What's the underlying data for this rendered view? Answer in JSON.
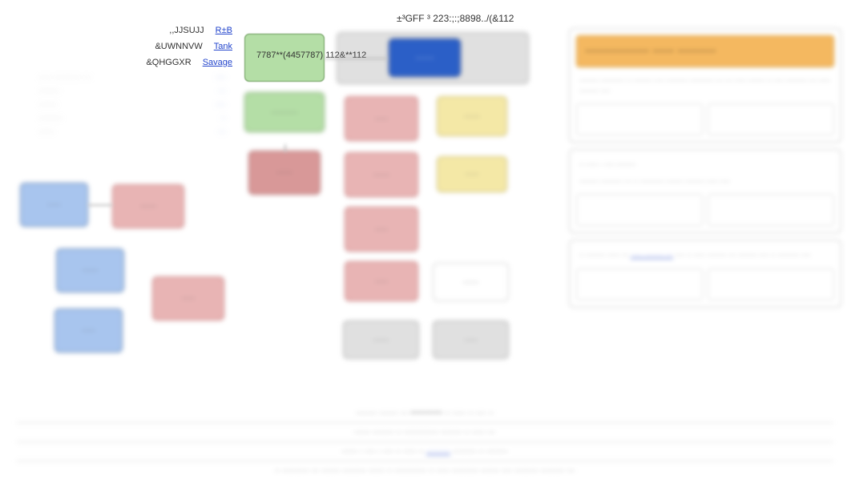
{
  "header": {
    "text": "±³GFF ³ 223:;:;8898../(&112"
  },
  "stats": {
    "rows": [
      {
        "label": ",,JJSUJJ",
        "link": "R±B"
      },
      {
        "label": "&UWNNVW",
        "link": "Tank"
      },
      {
        "label": "&QHGGXR",
        "link": "Savage"
      }
    ],
    "blur_rows": [
      {
        "label": "····· ·········· ···",
        "link": "····"
      },
      {
        "label": "········",
        "link": "···"
      },
      {
        "label": "·······",
        "link": "····"
      },
      {
        "label": "·········",
        "link": "··"
      },
      {
        "label": "······",
        "link": "···"
      }
    ]
  },
  "graph": {
    "focus_label": "7787**(4457787) 112&**112",
    "nodes": {
      "g1": "·····",
      "g2": "··········",
      "g3": "·····",
      "bd": "·······",
      "p1": "······",
      "p2": "·····",
      "p3": "······",
      "p4": "·····",
      "p5": "·····",
      "y1": "······",
      "y2": "·····",
      "b1": "·····",
      "b2": "······",
      "b3": "·····",
      "pk1": "······",
      "pk2": "·····",
      "gr1": "······",
      "gr2": "·····",
      "w1": "······",
      "w2": "·····"
    }
  },
  "right_panel": {
    "card1": {
      "header": "··············· ····· ·········",
      "body": "········ ·········· ·· ········ ···· ········· ·········· ··· ··· ····· ······· ·· ···· ········· ··· ····· ········ ····",
      "col_a": "",
      "col_b": ""
    },
    "card2": {
      "body_1": "·· ····· · ···· ········",
      "body_2": "········ ········· ··· ·· ·········· ······· ········ ····· ····",
      "col_a": "",
      "col_b": ""
    },
    "card3": {
      "body": "·· ········ ····· ··· ",
      "link_text": "····· ········ ···",
      "body_2": "···· ·· ····· ········ ··· ········ ···· ·· ········· ····",
      "col_a": "",
      "col_b": ""
    }
  },
  "bottom": {
    "line1_pre": "········ ······· ··· ",
    "line1_em": "············",
    "line1_post": " ·· ····· ·· ···· ··",
    "line2": "······ ········ ·· ············· ········ ·· ····· ···",
    "line3_pre": "······ · ···· · ···· ·· ····· ·· ",
    "line3_link": "·········",
    "line3_post": " ········· ·· ········",
    "line4": "·· ·········· ··· ······· ········· ······ ·· ············ ·· ····· ·········· ······· ···· ········· ········· ···"
  }
}
